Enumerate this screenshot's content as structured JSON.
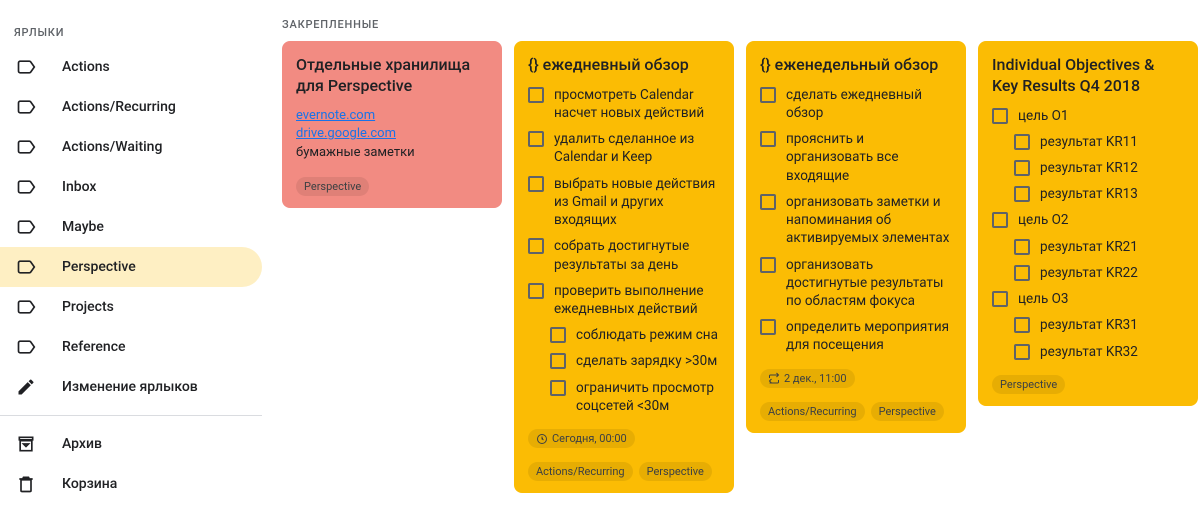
{
  "sidebar": {
    "label_header": "ЯРЛЫКИ",
    "items": [
      {
        "label": "Actions",
        "icon": "label"
      },
      {
        "label": "Actions/Recurring",
        "icon": "label"
      },
      {
        "label": "Actions/Waiting",
        "icon": "label"
      },
      {
        "label": "Inbox",
        "icon": "label"
      },
      {
        "label": "Maybe",
        "icon": "label"
      },
      {
        "label": "Perspective",
        "icon": "label",
        "active": true
      },
      {
        "label": "Projects",
        "icon": "label"
      },
      {
        "label": "Reference",
        "icon": "label"
      },
      {
        "label": "Изменение ярлыков",
        "icon": "pencil"
      }
    ],
    "footer": [
      {
        "label": "Архив",
        "icon": "archive"
      },
      {
        "label": "Корзина",
        "icon": "trash"
      }
    ]
  },
  "main_heading": "ЗАКРЕПЛЕННЫЕ",
  "notes": {
    "n0": {
      "title": "Отдельные хранилища для Perspective",
      "link1": "evernote.com",
      "link2": "drive.google.com",
      "body_line": "бумажные заметки",
      "chip1": "Perspective"
    },
    "n1": {
      "title": "{} ежедневный обзор",
      "items": [
        "просмотреть Calendar насчет новых действий",
        "удалить сделанное из Calendar и Keep",
        "выбрать новые действия из Gmail и других входящих",
        "собрать достигнутые результаты за день",
        "проверить выполнение ежедневных действий"
      ],
      "subitems": [
        "соблюдать режим сна",
        "сделать зарядку >30м",
        "ограничить просмотр соцсетей <30м"
      ],
      "reminder": "Сегодня, 00:00",
      "chip1": "Actions/Recurring",
      "chip2": "Perspective"
    },
    "n2": {
      "title": "{} еженедельный обзор",
      "items": [
        "сделать ежедневный обзор",
        "прояснить и организовать все входящие",
        "организовать заметки и напоминания об активируемых элементах",
        "организовать достигнутые результаты по областям фокуса",
        "определить мероприятия для посещения"
      ],
      "reminder": "2 дек., 11:00",
      "chip1": "Actions/Recurring",
      "chip2": "Perspective"
    },
    "n3": {
      "title": "Individual Objectives & Key Results Q4 2018",
      "items": [
        {
          "t": "цель O1",
          "sub": [
            "результат KR11",
            "результат KR12",
            "результат KR13"
          ]
        },
        {
          "t": "цель O2",
          "sub": [
            "результат KR21",
            "результат KR22"
          ]
        },
        {
          "t": "цель O3",
          "sub": [
            "результат KR31",
            "результат KR32"
          ]
        }
      ],
      "chip1": "Perspective"
    }
  }
}
